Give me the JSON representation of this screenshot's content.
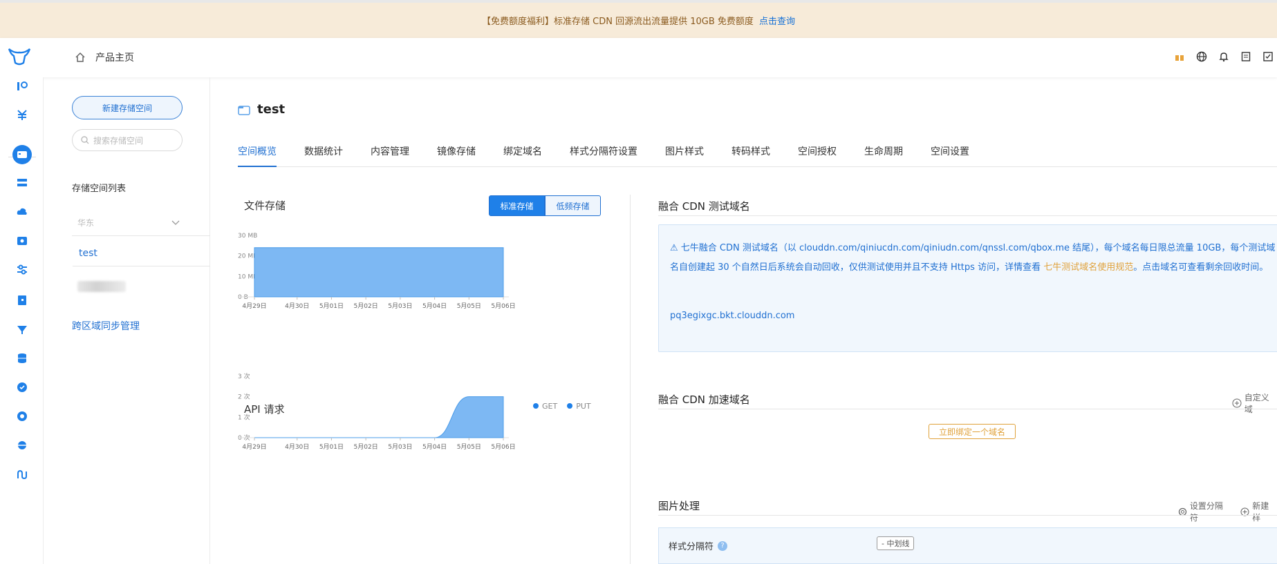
{
  "banner": {
    "text": "【免费额度福利】标准存储 CDN 回源流出流量提供 10GB 免费额度",
    "link": "点击查询"
  },
  "topbar": {
    "home_label": "产品主页"
  },
  "sidebar": {
    "new_bucket": "新建存储空间",
    "search_placeholder": "搜索存储空间",
    "list_title": "存储空间列表",
    "region": "华东",
    "active_bucket": "test",
    "cross_region": "跨区域同步管理"
  },
  "main": {
    "title": "test",
    "tabs": [
      "空间概览",
      "数据统计",
      "内容管理",
      "镜像存储",
      "绑定域名",
      "样式分隔符设置",
      "图片样式",
      "转码样式",
      "空间授权",
      "生命周期",
      "空间设置"
    ],
    "storage_toggle": {
      "standard": "标准存储",
      "infrequent": "低频存储"
    }
  },
  "colors": {
    "accent": "#1f80e8",
    "fill": "#7db8f3",
    "warn": "#e0a13a"
  },
  "chart_data": [
    {
      "type": "area",
      "title": "文件存储",
      "x": [
        "4月29日",
        "4月30日",
        "5月01日",
        "5月02日",
        "5月03日",
        "5月04日",
        "5月05日",
        "5月06日"
      ],
      "yticks": [
        "0 B",
        "10 MB",
        "20 MB",
        "30 MB"
      ],
      "ylim": [
        0,
        30
      ],
      "series": [
        {
          "values": [
            24,
            24,
            24,
            24,
            24,
            24,
            24,
            24
          ]
        }
      ]
    },
    {
      "type": "area",
      "title": "API 请求",
      "x": [
        "4月29日",
        "4月30日",
        "5月01日",
        "5月02日",
        "5月03日",
        "5月04日",
        "5月05日",
        "5月06日"
      ],
      "yticks": [
        "0 次",
        "1 次",
        "2 次",
        "3 次"
      ],
      "ylim": [
        0,
        3
      ],
      "legend": [
        "GET",
        "PUT"
      ],
      "series": [
        {
          "values": [
            0,
            0,
            0,
            0,
            0,
            0,
            2,
            2
          ]
        }
      ]
    }
  ],
  "cdn_test": {
    "title": "融合 CDN 测试域名",
    "notice": "七牛融合 CDN 测试域名（以 clouddn.com/qiniucdn.com/qiniudn.com/qnssl.com/qbox.me 结尾），每个域名每日限总流量 10GB，每个测试域名自创建起 30 个自然日后系统会自动回收，仅供测试使用并且不支持 Https 访问，详情查看",
    "notice_link": "七牛测试域名使用规范",
    "notice_tail": "。点击域名可查看剩余回收时间。",
    "domain": "pq3egixgc.bkt.clouddn.com"
  },
  "cdn_accel": {
    "title": "融合 CDN 加速域名",
    "custom": "自定义域",
    "bind": "立即绑定一个域名"
  },
  "image_proc": {
    "title": "图片处理",
    "set_sep": "设置分隔符",
    "new": "新建样",
    "sep_label": "样式分隔符",
    "sep_value": "- 中划线"
  }
}
